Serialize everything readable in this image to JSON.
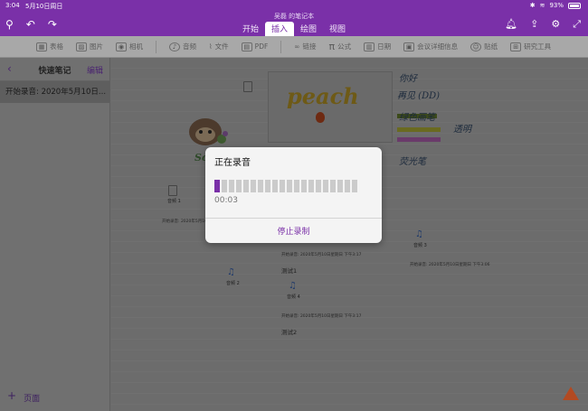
{
  "status_bar": {
    "time": "3:04",
    "date": "5月10日周日",
    "battery": "93%"
  },
  "header": {
    "notebook_title": "吴磊 的笔记本",
    "tabs": [
      {
        "label": "开始"
      },
      {
        "label": "插入",
        "active": true
      },
      {
        "label": "绘图"
      },
      {
        "label": "视图"
      }
    ]
  },
  "ribbon": {
    "items": [
      {
        "label": "表格",
        "icon": "table-icon"
      },
      {
        "label": "图片",
        "icon": "picture-icon"
      },
      {
        "label": "相机",
        "icon": "camera-icon"
      },
      {
        "label": "音频",
        "icon": "microphone-icon"
      },
      {
        "label": "文件",
        "icon": "paperclip-icon"
      },
      {
        "label": "PDF",
        "icon": "pdf-icon"
      },
      {
        "label": "链接",
        "icon": "link-icon"
      },
      {
        "label": "公式",
        "icon": "pi-icon"
      },
      {
        "label": "日期",
        "icon": "calendar-icon"
      },
      {
        "label": "会议详细信息",
        "icon": "meeting-icon"
      },
      {
        "label": "贴纸",
        "icon": "sticker-icon"
      },
      {
        "label": "研究工具",
        "icon": "research-icon"
      }
    ]
  },
  "sidebar": {
    "title": "快速笔记",
    "edit_label": "编辑",
    "pages": [
      {
        "label": "开始录音: 2020年5月10日..."
      }
    ],
    "add_page_label": "页面"
  },
  "canvas": {
    "photo_word": "peach",
    "sticker_text": "So",
    "handwriting": {
      "line1": "你好",
      "line2": "再见 (DD)",
      "line3": "绿色画笔",
      "line4": "荧光笔",
      "line5": "橡皮擦",
      "line6": "透明"
    },
    "files": [
      {
        "label": "音频 1"
      },
      {
        "label": "音频 2"
      },
      {
        "label": "音频 3"
      },
      {
        "label": "音频 4"
      }
    ],
    "stamps": [
      "开始录音: 2020年5月10日星期日 下午3:2",
      "开始录音: 2020年5月10日星期日 下午3:17",
      "开始录音: 2020年5月10日星期日 下午3:06",
      "开始录音: 2020年5月10日星期日 下午3:17"
    ],
    "notes": [
      "测试1",
      "测试2"
    ]
  },
  "dialog": {
    "title": "正在录音",
    "timer": "00:03",
    "stop_label": "停止录制",
    "level": 0.06
  },
  "colors": {
    "brand": "#7a30a8",
    "dialog_bg": "#f4f4f4",
    "meter_active": "#7a30a8"
  }
}
